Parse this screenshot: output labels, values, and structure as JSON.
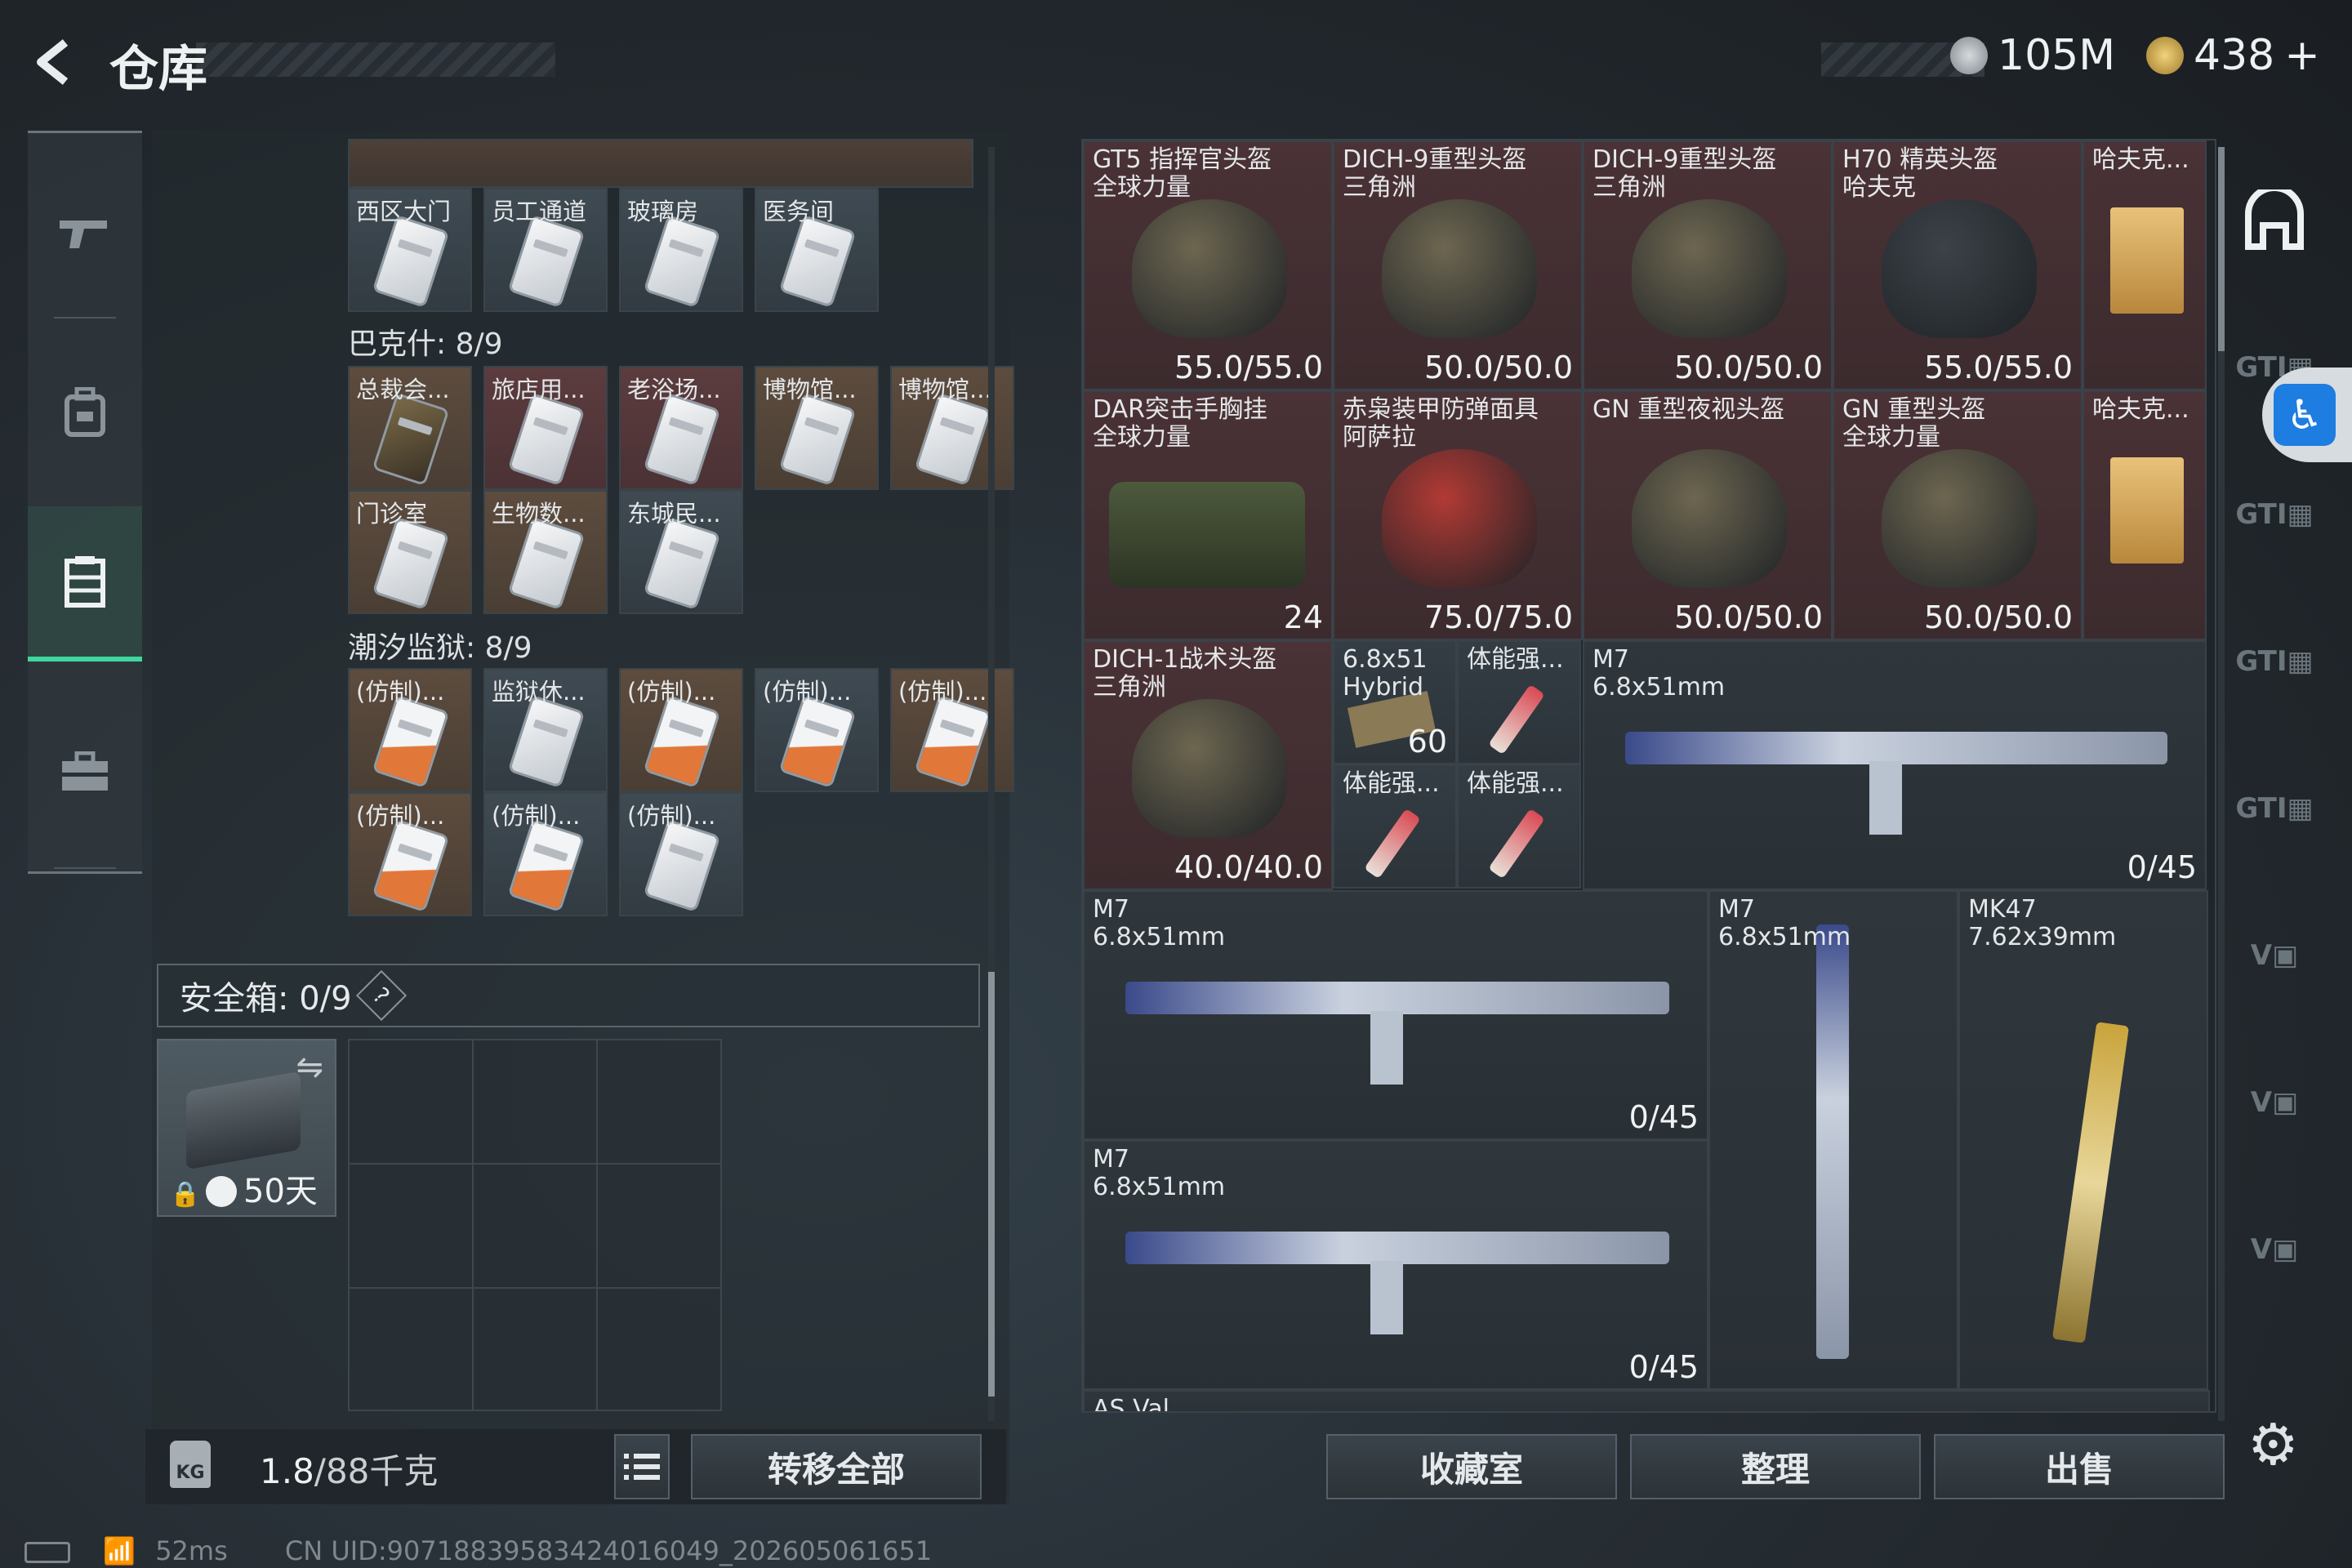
{
  "header": {
    "title": "仓库",
    "currency1": "105M",
    "currency2": "438",
    "plus": "+"
  },
  "sidebar": {
    "items": [
      "gun-icon",
      "backpack-icon",
      "warehouse-icon",
      "toolbox-icon"
    ]
  },
  "left": {
    "rows1": [
      {
        "label": "西区大门",
        "style": "gray"
      },
      {
        "label": "员工通道",
        "style": "gray"
      },
      {
        "label": "玻璃房",
        "style": "gray"
      },
      {
        "label": "医务间",
        "style": "gray"
      }
    ],
    "section2": "巴克什: 8/9",
    "rows2a": [
      {
        "label": "总裁会...",
        "style": "gold",
        "card": "dark"
      },
      {
        "label": "旅店用...",
        "style": "red"
      },
      {
        "label": "老浴场...",
        "style": "red"
      },
      {
        "label": "博物馆...",
        "style": "gold"
      },
      {
        "label": "博物馆...",
        "style": "gold"
      }
    ],
    "rows2b": [
      {
        "label": "门诊室",
        "style": "gold"
      },
      {
        "label": "生物数...",
        "style": "gold"
      },
      {
        "label": "东城民...",
        "style": "gray"
      }
    ],
    "section3": "潮汐监狱: 8/9",
    "rows3a": [
      {
        "label": "(仿制)...",
        "style": "gold",
        "card": "orange"
      },
      {
        "label": "监狱休...",
        "style": "gray"
      },
      {
        "label": "(仿制)...",
        "style": "gold",
        "card": "orange"
      },
      {
        "label": "(仿制)...",
        "style": "gray",
        "card": "orange"
      },
      {
        "label": "(仿制)...",
        "style": "gold",
        "card": "orange"
      }
    ],
    "rows3b": [
      {
        "label": "(仿制)...",
        "style": "gold",
        "card": "orange"
      },
      {
        "label": "(仿制)...",
        "style": "gray",
        "card": "orange"
      },
      {
        "label": "(仿制)...",
        "style": "gray"
      }
    ],
    "safebox_label": "安全箱: 0/9",
    "safebox_help": "?",
    "safe_days": "50天",
    "weight_value": "1.8",
    "weight_max": "/88千克",
    "transfer_all": "转移全部"
  },
  "right": {
    "items": [
      {
        "n1": "GT5 指挥官头盔",
        "n2": "全球力量",
        "dur": "55.0/55.0",
        "style": "red"
      },
      {
        "n1": "DICH-9重型头盔",
        "n2": "三角洲",
        "dur": "50.0/50.0",
        "style": "red"
      },
      {
        "n1": "DICH-9重型头盔",
        "n2": "三角洲",
        "dur": "50.0/50.0",
        "style": "red"
      },
      {
        "n1": "H70 精英头盔",
        "n2": "哈夫克",
        "dur": "55.0/55.0",
        "style": "red"
      },
      {
        "n1": "哈夫克...",
        "n2": "",
        "dur": "",
        "style": "red"
      },
      {
        "n1": "DAR突击手胸挂",
        "n2": "全球力量",
        "dur": "24",
        "style": "red"
      },
      {
        "n1": "赤枭装甲防弹面具",
        "n2": "阿萨拉",
        "dur": "75.0/75.0",
        "style": "red"
      },
      {
        "n1": "GN 重型夜视头盔",
        "n2": "",
        "dur": "50.0/50.0",
        "style": "red"
      },
      {
        "n1": "GN 重型头盔",
        "n2": "全球力量",
        "dur": "50.0/50.0",
        "style": "red"
      },
      {
        "n1": "哈夫克...",
        "n2": "",
        "dur": "",
        "style": "red"
      },
      {
        "n1": "DICH-1战术头盔",
        "n2": "三角洲",
        "dur": "40.0/40.0",
        "style": "red"
      },
      {
        "n1": "6.8x51",
        "n2": "Hybrid",
        "dur": "60",
        "style": "gray"
      },
      {
        "n1": "体能强...",
        "n2": "",
        "dur": "",
        "style": "gray"
      },
      {
        "n1": "体能强...",
        "n2": "",
        "dur": "",
        "style": "gray"
      },
      {
        "n1": "体能强...",
        "n2": "",
        "dur": "",
        "style": "gray"
      },
      {
        "n1": "M7",
        "n2": "6.8x51mm",
        "dur": "0/45",
        "style": "dark"
      },
      {
        "n1": "M7",
        "n2": "6.8x51mm",
        "dur": "0/45",
        "style": "dark"
      },
      {
        "n1": "M7",
        "n2": "6.8x51mm",
        "dur": "",
        "style": "dark"
      },
      {
        "n1": "MK47",
        "n2": "7.62x39mm",
        "dur": "",
        "style": "dark"
      },
      {
        "n1": "M7",
        "n2": "6.8x51mm",
        "dur": "0/45",
        "style": "dark"
      },
      {
        "n1": "AS Val",
        "n2": "",
        "dur": "",
        "style": "dark"
      }
    ],
    "buttons": {
      "collection": "收藏室",
      "sort": "整理",
      "sell": "出售"
    }
  },
  "status": {
    "ping": "52ms",
    "uid": "CN UID:9071883958342401604​9_202605061651"
  },
  "colors": {
    "accent": "#3fd6a0",
    "red_rarity": "#4a3236",
    "gold_rarity": "#5d4c3e",
    "blue_button": "#1e7de0"
  }
}
